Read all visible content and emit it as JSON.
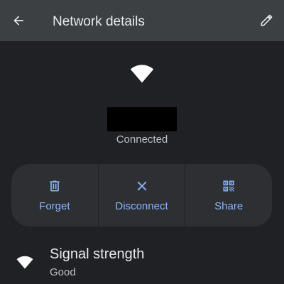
{
  "app_bar": {
    "title": "Network details",
    "back_icon": "arrow-back-icon",
    "edit_icon": "pencil-icon"
  },
  "header": {
    "icon": "wifi-icon",
    "network_name_redacted": true,
    "status": "Connected"
  },
  "actions": [
    {
      "label": "Forget",
      "icon": "trash-icon"
    },
    {
      "label": "Disconnect",
      "icon": "close-icon"
    },
    {
      "label": "Share",
      "icon": "qr-code-icon"
    }
  ],
  "details": [
    {
      "title": "Signal strength",
      "value": "Good",
      "icon": "wifi-icon"
    }
  ],
  "colors": {
    "background": "#202124",
    "app_bar": "#3c4043",
    "card": "#2d2f33",
    "accent": "#8ab4f8",
    "text_primary": "#e8eaed",
    "text_secondary": "#bdc1c6"
  }
}
